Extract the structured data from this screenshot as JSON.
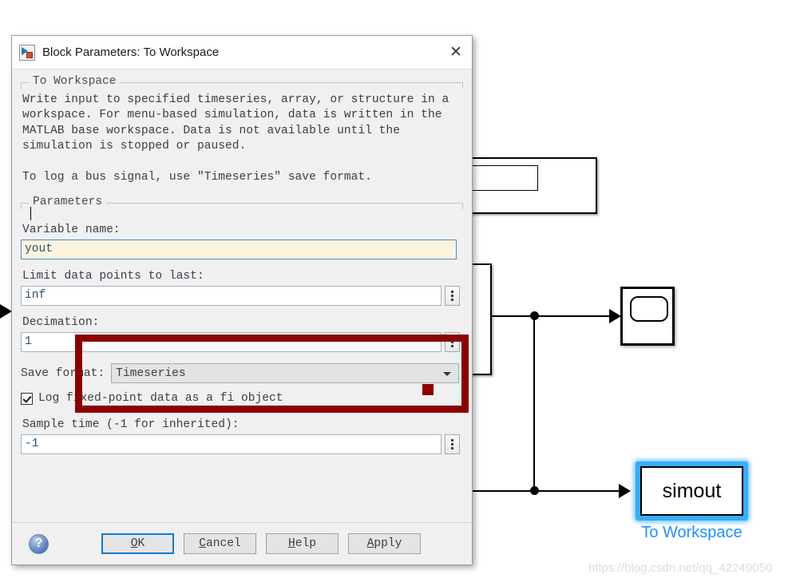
{
  "dialog": {
    "title": "Block Parameters: To Workspace",
    "title_icon": "simulink-block-icon",
    "close_icon": "close-icon",
    "description_group": {
      "legend": "To Workspace",
      "text": "Write input to specified timeseries, array, or structure in a\nworkspace. For menu-based simulation, data is written in the\nMATLAB base workspace. Data is not available until the\nsimulation is stopped or paused.\n\nTo log a bus signal, use \"Timeseries\" save format."
    },
    "parameters_group": {
      "legend": "Parameters",
      "variable_name": {
        "label": "Variable name:",
        "value": "yout"
      },
      "limit_data_points": {
        "label": "Limit data points to last:",
        "value": "inf",
        "picker_icon": "vertical-dots-icon"
      },
      "decimation": {
        "label": "Decimation:",
        "value": "1",
        "picker_icon": "vertical-dots-icon"
      },
      "save_format": {
        "label": "Save format:",
        "value": "Timeseries",
        "arrow_icon": "chevron-down-icon"
      },
      "log_fixed_point": {
        "label": "Log fixed-point data as a fi object",
        "checked": true
      },
      "sample_time": {
        "label": "Sample time (-1 for inherited):",
        "value": "-1",
        "picker_icon": "vertical-dots-icon"
      }
    },
    "buttons": {
      "help_icon": "help-question-icon",
      "ok": "OK",
      "ok_mnemonic": "O",
      "ok_rest": "K",
      "cancel": "Cancel",
      "cancel_mnemonic": "C",
      "cancel_rest": "ancel",
      "help": "Help",
      "help_mnemonic": "H",
      "help_rest": "elp",
      "apply": "Apply",
      "apply_mnemonic": "A",
      "apply_rest": "pply"
    }
  },
  "canvas": {
    "scope_block": {
      "name": "scope-block",
      "icon": "scope-icon"
    },
    "simout_block": {
      "text": "simout",
      "caption": "To Workspace",
      "selected": true,
      "selection_color": "#35aef5",
      "caption_color": "#1e90ff"
    },
    "watermark": "https://blog.csdn.net/qq_42249050"
  },
  "annotation": {
    "box_color": "#8b0000",
    "marker": "red-square-marker"
  }
}
